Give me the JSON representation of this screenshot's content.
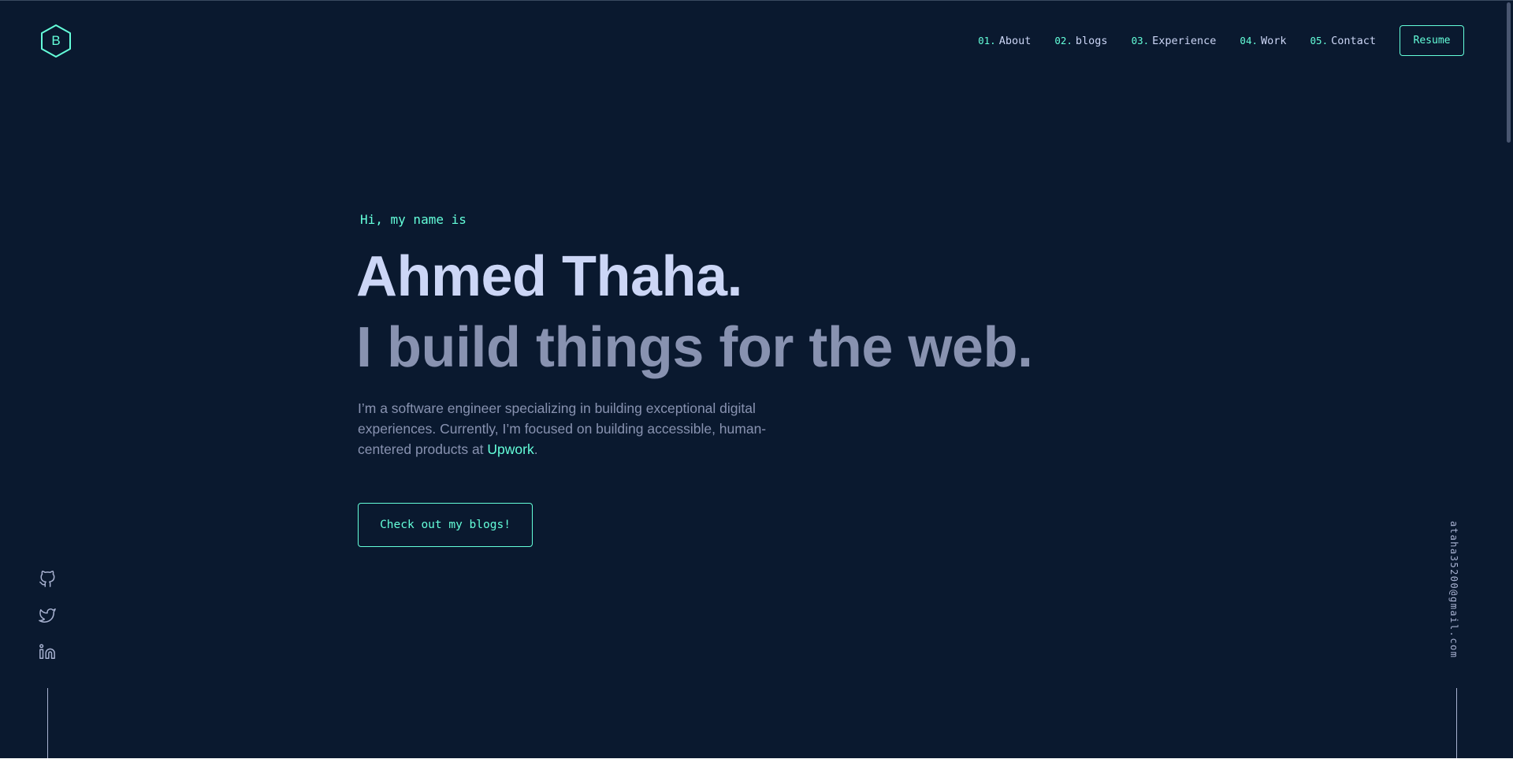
{
  "header": {
    "logo_letter": "B",
    "nav": [
      {
        "num": "01.",
        "label": "About"
      },
      {
        "num": "02.",
        "label": "blogs"
      },
      {
        "num": "03.",
        "label": "Experience"
      },
      {
        "num": "04.",
        "label": "Work"
      },
      {
        "num": "05.",
        "label": "Contact"
      }
    ],
    "resume_label": "Resume"
  },
  "hero": {
    "intro": "Hi, my name is",
    "name": "Ahmed Thaha.",
    "tagline": "I build things for the web.",
    "bio_text": "I’m a software engineer specializing in building exceptional digital experiences. Currently, I’m focused on building accessible, human-centered products at ",
    "bio_link": "Upwork",
    "bio_end": ".",
    "cta_label": "Check out my blogs!"
  },
  "social": [
    {
      "icon": "github-icon"
    },
    {
      "icon": "twitter-icon"
    },
    {
      "icon": "linkedin-icon"
    }
  ],
  "email": "ataha35200@gmail.com",
  "colors": {
    "background": "#0a192f",
    "accent": "#64ffda",
    "heading": "#ccd6f6",
    "muted": "#8892b0"
  }
}
